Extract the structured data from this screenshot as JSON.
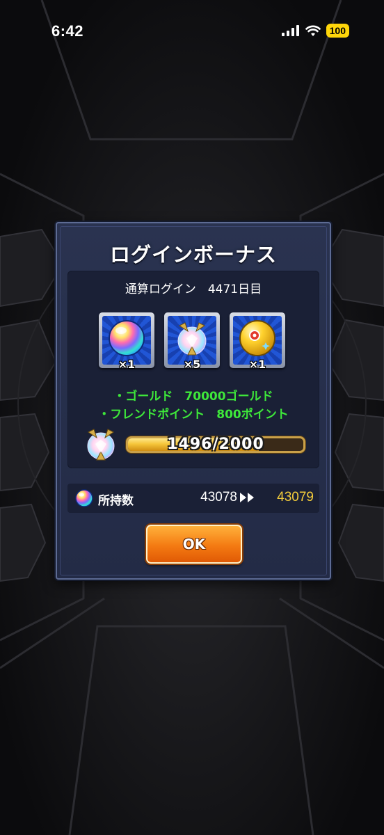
{
  "status_bar": {
    "time": "6:42",
    "battery": "100",
    "icons": [
      "cellular-signal-icon",
      "wifi-icon",
      "battery-icon"
    ]
  },
  "dialog": {
    "title": "ログインボーナス",
    "login_count": "通算ログイン　4471日目",
    "items": [
      {
        "icon": "rainbow-orb-icon",
        "quantity": "×1"
      },
      {
        "icon": "crystal-gem-icon",
        "quantity": "×5"
      },
      {
        "icon": "gold-orb-icon",
        "quantity": "×1"
      }
    ],
    "rewards": [
      "・ゴールド　70000ゴールド",
      "・フレンドポイント　800ポイント"
    ],
    "progress": {
      "icon": "crystal-gem-icon",
      "text": "1496/2000",
      "current": 1496,
      "max": 2000
    },
    "owned": {
      "icon": "rainbow-orb-icon",
      "label": "所持数",
      "before": "43078",
      "after": "43079"
    },
    "ok_label": "OK"
  },
  "colors": {
    "reward_text": "#3ee83a",
    "owned_new": "#f3cc3b",
    "ok_button": "#f47a12",
    "battery_badge": "#ffd60a"
  }
}
